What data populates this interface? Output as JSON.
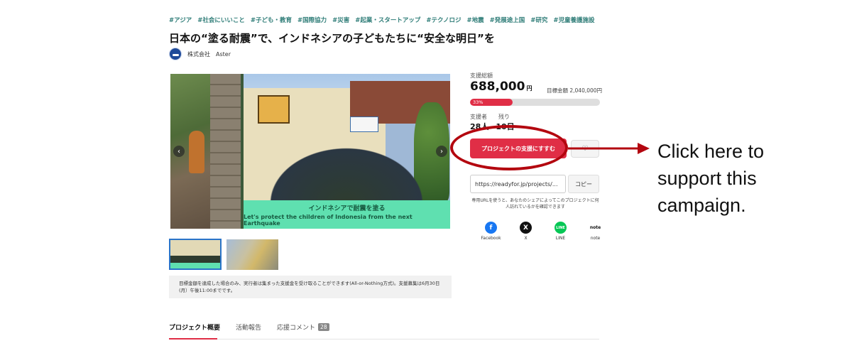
{
  "tags": [
    "#アジア",
    "#社会にいいこと",
    "#子ども・教育",
    "#国際協力",
    "#災害",
    "#起業・スタートアップ",
    "#テクノロジ",
    "#地震",
    "#発展途上国",
    "#研究",
    "#児童養護施設"
  ],
  "title": "日本の“塗る耐震”で、インドネシアの子どもたちに“安全な明日”を",
  "organizer": {
    "type": "株式会社",
    "name": "Aster"
  },
  "gallery": {
    "banner_jp": "インドネシアで耐震を塗る",
    "banner_en": "Let's protect the children of Indonesia from the next Earthquake",
    "prev_icon": "chevron-left-icon",
    "next_icon": "chevron-right-icon"
  },
  "notice": "目標金額を達成した場合のみ、実行者は集まった支援金を受け取ることができます(All-or-Nothing方式)。支援募集は6月30日(月）午後11:00までです。",
  "funding": {
    "amount_label": "支援総額",
    "amount": "688,000",
    "unit": "円",
    "goal_label": "目標金額 2,040,000円",
    "progress_percent": 33,
    "progress_text": "33%",
    "supporters_label": "支援者",
    "supporters": "28人",
    "remaining_label": "残り",
    "remaining": "10日"
  },
  "support_button": "プロジェクトの支援にすすむ",
  "favorite_icon": "heart-icon",
  "share": {
    "url": "https://readyfor.jp/projects/...",
    "copy_label": "コピー",
    "note": "専用URLを使うと、あなたのシェアによってこのプロジェクトに何人訪れているかを確認できます"
  },
  "social": [
    {
      "label": "Facebook",
      "glyph": "f",
      "icon": "facebook-icon"
    },
    {
      "label": "X",
      "glyph": "X",
      "icon": "x-icon"
    },
    {
      "label": "LINE",
      "glyph": "LINE",
      "icon": "line-icon"
    },
    {
      "label": "note",
      "glyph": "note",
      "icon": "note-icon"
    }
  ],
  "tabs": [
    {
      "label": "プロジェクト概要",
      "active": true
    },
    {
      "label": "活動報告"
    },
    {
      "label": "応援コメント",
      "badge": "28"
    }
  ],
  "callout": "Click here to support this campaign.",
  "colors": {
    "accent": "#e02e46",
    "highlight": "#b3060f",
    "tag": "#2f7d78"
  }
}
